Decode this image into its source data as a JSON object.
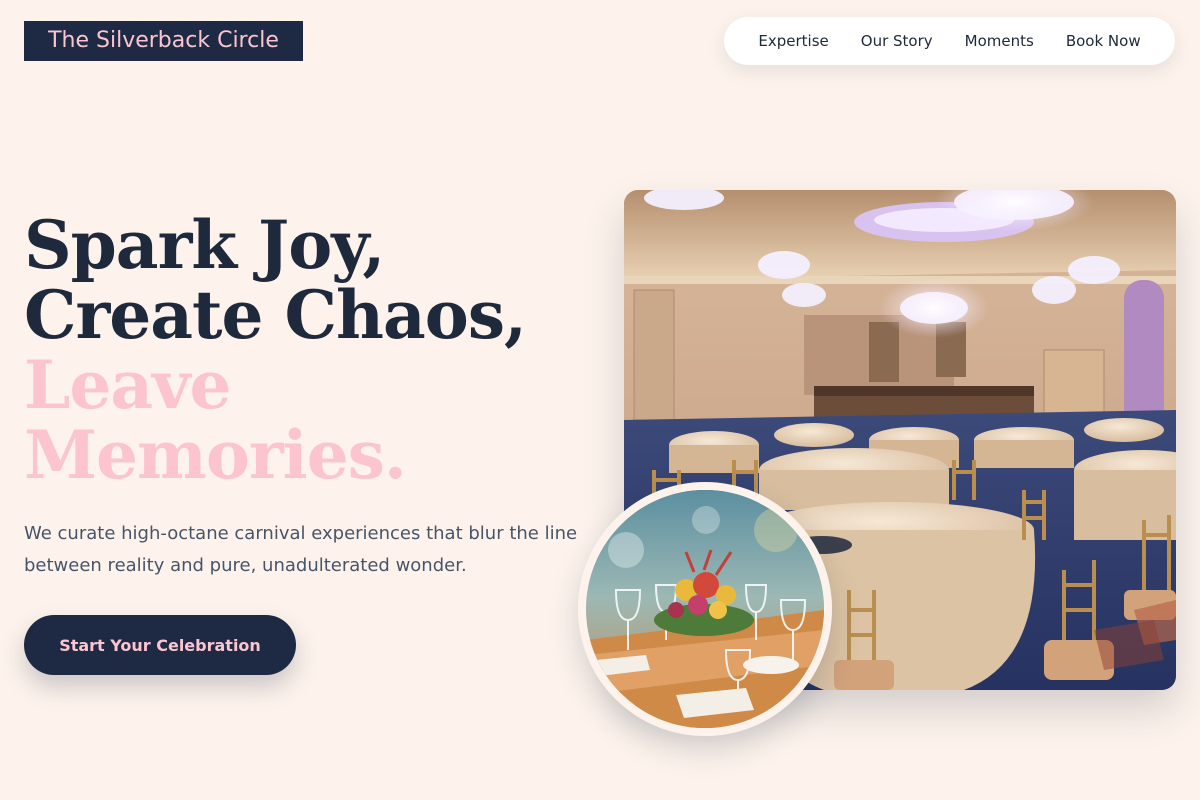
{
  "brand": {
    "name": "The Silverback Circle"
  },
  "nav": {
    "items": [
      {
        "label": "Expertise"
      },
      {
        "label": "Our Story"
      },
      {
        "label": "Moments"
      },
      {
        "label": "Book Now"
      }
    ]
  },
  "hero": {
    "headline_lines": [
      "Spark Joy,",
      "Create Chaos,",
      "Leave",
      "Memories."
    ],
    "subtitle": "We curate high-octane carnival experiences that blur the line between reality and pure, unadulterated wonder.",
    "cta_label": "Start Your Celebration"
  },
  "colors": {
    "background": "#fdf3ec",
    "navy": "#1e2a44",
    "pink_accent": "#fbc4cf"
  }
}
